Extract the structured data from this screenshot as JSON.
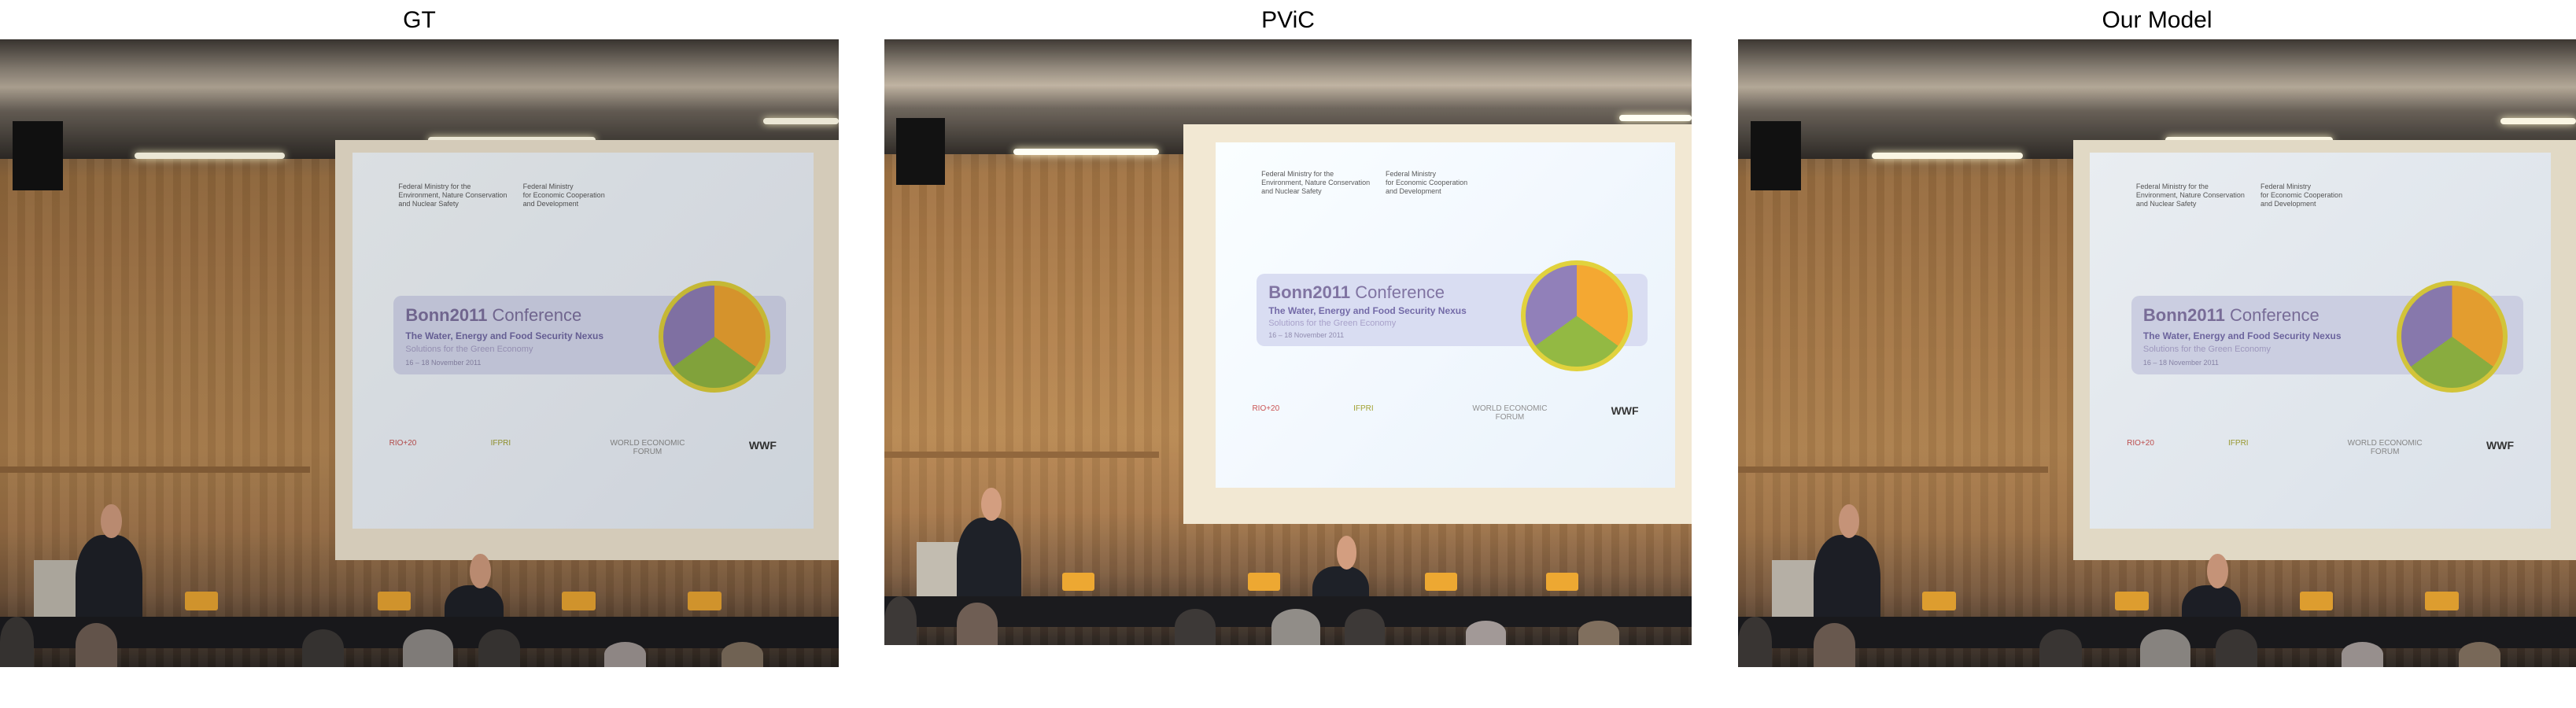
{
  "panels": [
    {
      "title": "GT"
    },
    {
      "title": "PViC"
    },
    {
      "title": "Our Model"
    }
  ],
  "slide": {
    "ministry_env": "Federal Ministry for the\nEnvironment, Nature Conservation\nand Nuclear Safety",
    "ministry_econ": "Federal Ministry\nfor Economic Cooperation\nand Development",
    "conference_bold": "Bonn2011",
    "conference_rest": " Conference",
    "subtitle": "The Water, Energy and Food Security Nexus",
    "subtitle2": "Solutions for the Green Economy",
    "date": "16 – 18 November 2011",
    "logos": [
      "RIO+20",
      "IFPRI",
      "WORLD ECONOMIC FORUM",
      "WWF"
    ]
  }
}
